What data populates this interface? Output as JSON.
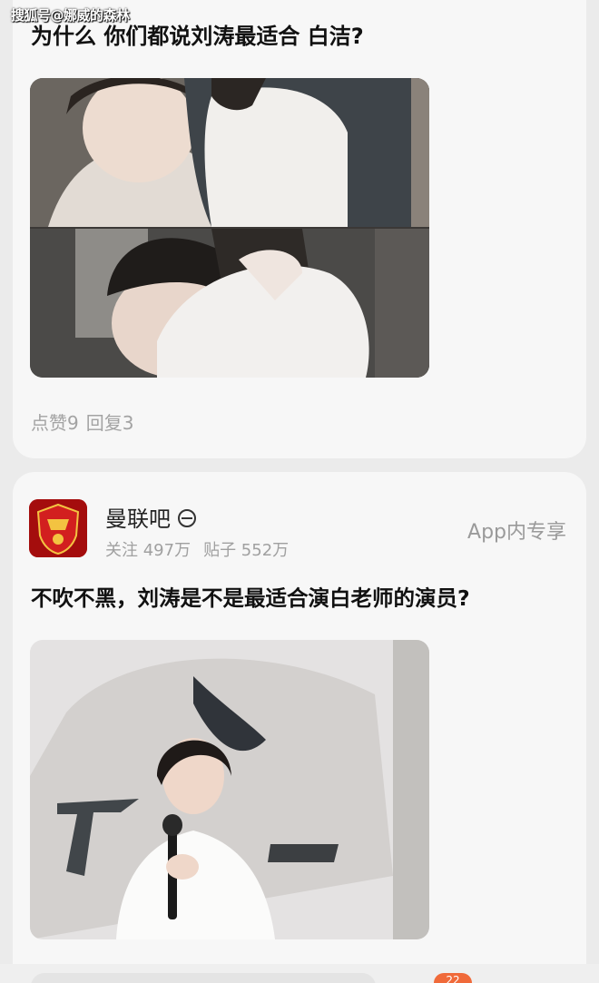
{
  "watermark": "搜狐号@娜威的森林",
  "post1": {
    "title": "为什么 你们都说刘涛最适合 白洁?",
    "likes": "点赞9",
    "replies": "回复3"
  },
  "post2": {
    "forum": {
      "name": "曼联吧",
      "follow": "关注 497万",
      "posts": "贴子 552万",
      "share": "App内专享"
    },
    "title": "不吹不黑，刘涛是不是最适合演白老师的演员?"
  },
  "bottom": {
    "badge": "22"
  }
}
